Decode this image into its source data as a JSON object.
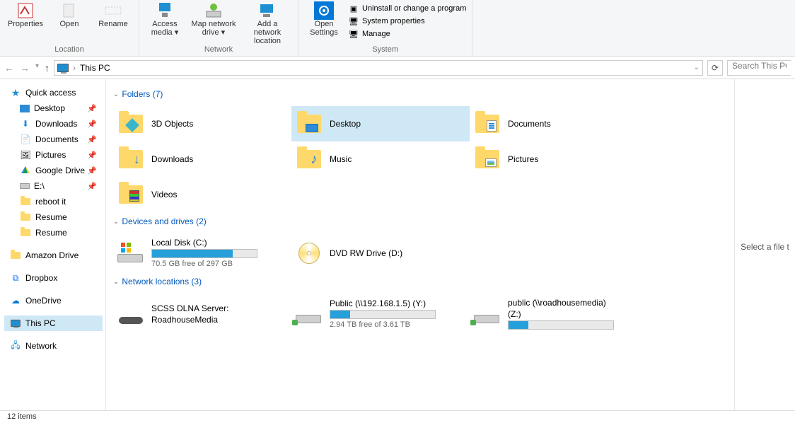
{
  "ribbon": {
    "properties": "Properties",
    "open": "Open",
    "rename": "Rename",
    "access_media": "Access media",
    "map_drive": "Map network drive",
    "add_loc": "Add a network location",
    "open_settings": "Open Settings",
    "uninstall": "Uninstall or change a program",
    "sys_props": "System properties",
    "manage": "Manage",
    "group_location": "Location",
    "group_network": "Network",
    "group_system": "System"
  },
  "addressbar": {
    "path": "This PC",
    "search_placeholder": "Search This PC"
  },
  "nav": {
    "quick_access": "Quick access",
    "desktop": "Desktop",
    "downloads": "Downloads",
    "documents": "Documents",
    "pictures": "Pictures",
    "gdrive": "Google Drive",
    "e_drive": "E:\\",
    "reboot_it": "reboot it",
    "resume1": "Resume",
    "resume2": "Resume",
    "amazon": "Amazon Drive",
    "dropbox": "Dropbox",
    "onedrive": "OneDrive",
    "this_pc": "This PC",
    "network": "Network"
  },
  "sections": {
    "folders": "Folders (7)",
    "drives": "Devices and drives (2)",
    "netloc": "Network locations (3)"
  },
  "folders": {
    "objects3d": "3D Objects",
    "desktop": "Desktop",
    "documents": "Documents",
    "downloads": "Downloads",
    "music": "Music",
    "pictures": "Pictures",
    "videos": "Videos"
  },
  "drives": {
    "local": {
      "label": "Local Disk (C:)",
      "free": "70.5 GB free of 297 GB",
      "fill_pct": 77
    },
    "dvd": {
      "label": "DVD RW Drive (D:)"
    }
  },
  "netloc": {
    "scss": {
      "label1": "SCSS DLNA Server:",
      "label2": "RoadhouseMedia"
    },
    "publicY": {
      "label": "Public (\\\\192.168.1.5) (Y:)",
      "free": "2.94 TB free of 3.61 TB",
      "fill_pct": 19
    },
    "publicZ": {
      "label1": "public (\\\\roadhousemedia)",
      "label2": "(Z:)",
      "fill_pct": 19
    }
  },
  "details": {
    "prompt": "Select a file t"
  },
  "status": {
    "items": "12 items"
  }
}
